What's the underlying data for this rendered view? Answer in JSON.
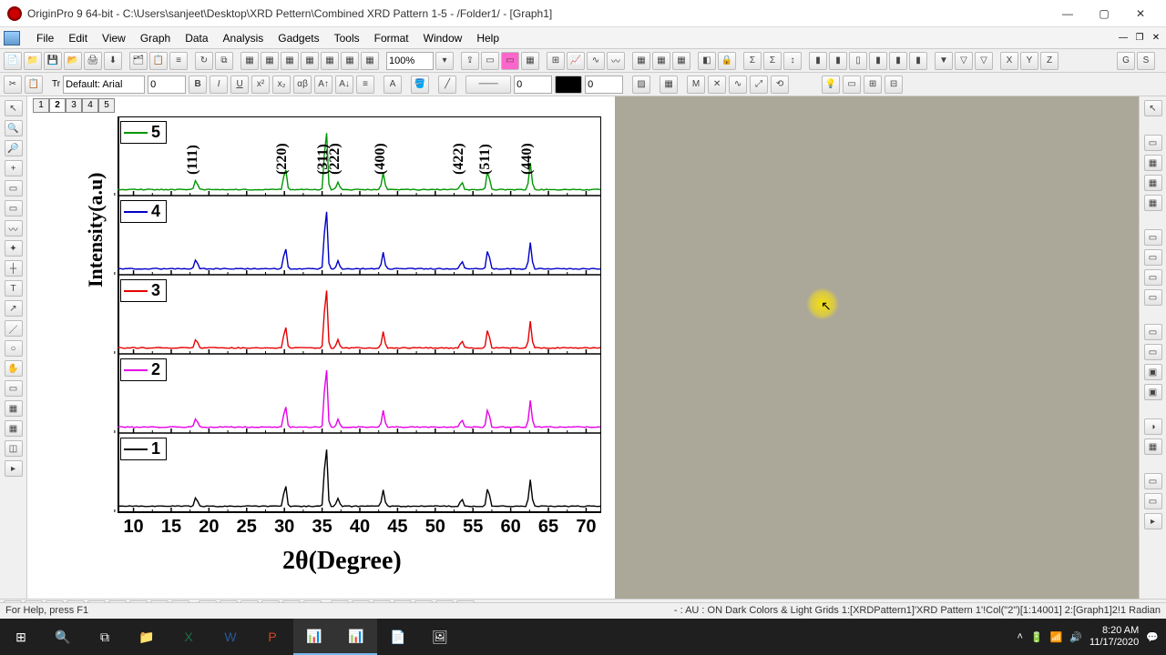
{
  "window": {
    "title": "OriginPro 9 64-bit - C:\\Users\\sanjeet\\Desktop\\XRD Pettern\\Combined XRD Pattern 1-5 - /Folder1/ - [Graph1]"
  },
  "menu": {
    "items": [
      "File",
      "Edit",
      "View",
      "Graph",
      "Data",
      "Analysis",
      "Gadgets",
      "Tools",
      "Format",
      "Window",
      "Help"
    ]
  },
  "toolbar": {
    "zoom": "100%",
    "font_label": "Default: Arial",
    "font_size": "0",
    "num1": "0",
    "num2": "0",
    "letters": [
      "X",
      "Y",
      "Z",
      "G",
      "S",
      "M"
    ]
  },
  "layer_tabs": [
    "1",
    "2",
    "3",
    "4",
    "5"
  ],
  "chart_data": {
    "type": "line",
    "title": "",
    "xlabel": "2θ(Degree)",
    "ylabel": "Intensity(a.u)",
    "x_ticks": [
      10,
      15,
      20,
      25,
      30,
      35,
      40,
      45,
      50,
      55,
      60,
      65,
      70
    ],
    "xlim": [
      8,
      72
    ],
    "panels": [
      {
        "legend": "5",
        "color": "#009600",
        "peak_labels": [
          "(111)",
          "(220)",
          "(311)",
          "(222)",
          "(400)",
          "(422)",
          "(511)",
          "(440)"
        ]
      },
      {
        "legend": "4",
        "color": "#0000c8"
      },
      {
        "legend": "3",
        "color": "#e60000"
      },
      {
        "legend": "2",
        "color": "#e600e6"
      },
      {
        "legend": "1",
        "color": "#000000"
      }
    ],
    "peaks_x": [
      18.3,
      30.1,
      35.5,
      37.1,
      43.1,
      53.5,
      57.0,
      62.6
    ],
    "peaks_h": [
      0.15,
      0.35,
      1.0,
      0.12,
      0.25,
      0.12,
      0.3,
      0.4
    ]
  },
  "status": {
    "left": "For Help, press F1",
    "right": "- : AU : ON  Dark Colors & Light Grids  1:[XRDPattern1]'XRD Pattern 1'!Col(\"2\")[1:14001]  2:[Graph1]2!1  Radian"
  },
  "systray": {
    "time": "8:20 AM",
    "date": "11/17/2020"
  },
  "taskbar_apps": [
    "start",
    "search",
    "taskview",
    "explorer",
    "excel",
    "word",
    "powerpoint",
    "origin",
    "origin2",
    "notepad",
    "photos"
  ]
}
